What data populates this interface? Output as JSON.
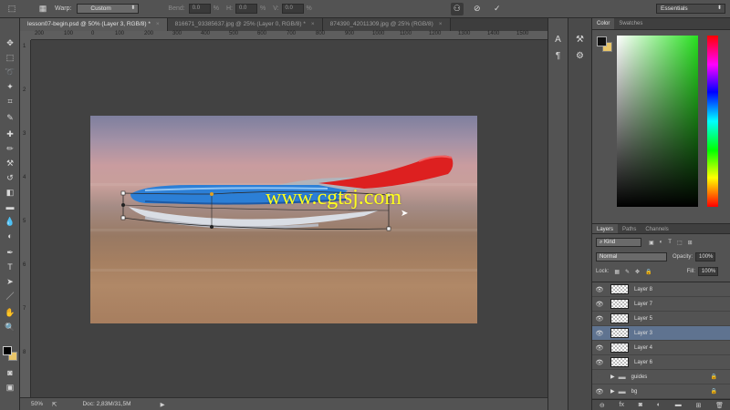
{
  "options_bar": {
    "warp_label": "Warp:",
    "warp_value": "Custom",
    "bend_label": "Bend:",
    "bend_value": "0.0",
    "h_label": "H:",
    "h_value": "0.0",
    "v_label": "V:",
    "v_value": "0.0",
    "percent": "%",
    "workspace": "Essentials"
  },
  "tabs": [
    {
      "label": "lesson07-begin.psd @ 50% (Layer 3, RGB/8) *",
      "close": "×"
    },
    {
      "label": "816671_93385637.jpg @ 25% (Layer 0, RGB/8) *",
      "close": "×"
    },
    {
      "label": "874390_42011309.jpg @ 25% (RGB/8)",
      "close": "×"
    }
  ],
  "ruler_ticks": [
    "200",
    "100",
    "0",
    "100",
    "200",
    "300",
    "400",
    "500",
    "600",
    "700",
    "800",
    "900",
    "1000",
    "1100",
    "1200",
    "1300",
    "1400",
    "1500"
  ],
  "ruler_left_ticks": [
    "1",
    "2",
    "3",
    "4",
    "5",
    "6",
    "7",
    "8"
  ],
  "watermark": "www.cgtsj.com",
  "status": {
    "zoom": "50%",
    "doc": "Doc: 2,83M/31,5M"
  },
  "color_panel": {
    "tabs": [
      "Color",
      "Swatches"
    ],
    "fg": "#111111",
    "bg": "#e8c56a"
  },
  "layers_panel": {
    "tabs": [
      "Layers",
      "Paths",
      "Channels"
    ],
    "kind_label": "Kind",
    "blend_mode": "Normal",
    "opacity_label": "Opacity:",
    "opacity_value": "100%",
    "lock_label": "Lock:",
    "fill_label": "Fill:",
    "fill_value": "100%",
    "layers": [
      {
        "name": "Layer 8",
        "visible": true,
        "selected": false
      },
      {
        "name": "Layer 7",
        "visible": true,
        "selected": false
      },
      {
        "name": "Layer 5",
        "visible": true,
        "selected": false
      },
      {
        "name": "Layer 3",
        "visible": true,
        "selected": true
      },
      {
        "name": "Layer 4",
        "visible": true,
        "selected": false
      },
      {
        "name": "Layer 6",
        "visible": true,
        "selected": false
      },
      {
        "name": "guides",
        "visible": false,
        "selected": false,
        "group": true,
        "locked": true
      },
      {
        "name": "bg",
        "visible": true,
        "selected": false,
        "group": true,
        "locked": true
      }
    ]
  },
  "colors": {
    "selection_blue": "#5f7390",
    "watermark_yellow": "#ffff1e"
  }
}
